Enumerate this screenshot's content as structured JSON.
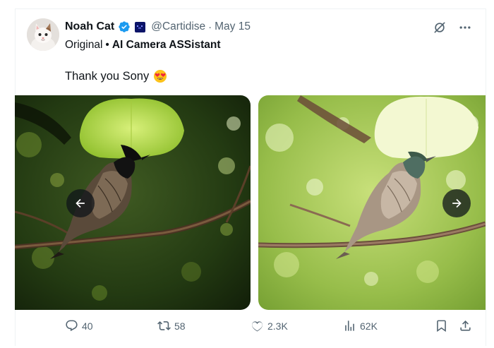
{
  "author": {
    "name": "Noah Cat",
    "handle": "@Cartidise",
    "separator": "·",
    "date": "May 15",
    "verified": true,
    "avatar_icon": "cat-avatar"
  },
  "subline": {
    "original": "Original",
    "separator": "•",
    "ai_label": "AI Camera ASSistant"
  },
  "tweet": {
    "text": "Thank you Sony",
    "emoji": "heart-eyes-emoji"
  },
  "media": {
    "images": [
      {
        "name": "bird-photo-original",
        "icon": "bird-on-branch-dark"
      },
      {
        "name": "bird-photo-edited",
        "icon": "bird-on-branch-bright"
      }
    ]
  },
  "actions": {
    "replies": "40",
    "reposts": "58",
    "likes": "2.3K",
    "views": "62K"
  },
  "colors": {
    "verified_blue": "#1d9bf0",
    "text_primary": "#0f1419",
    "text_secondary": "#536471",
    "affiliate_badge": "#0c1468"
  }
}
